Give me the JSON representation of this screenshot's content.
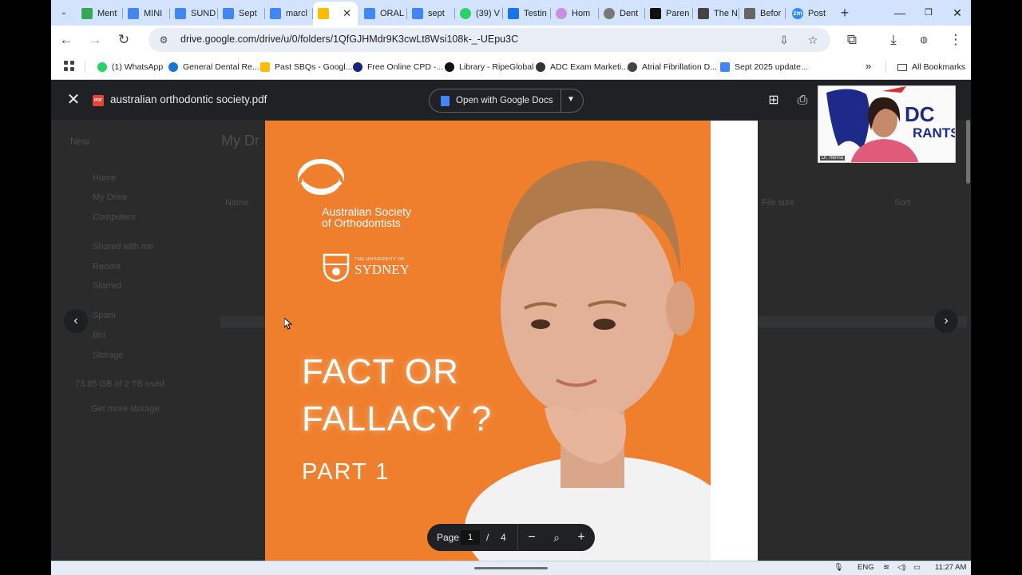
{
  "browser": {
    "tabs": [
      {
        "label": "Ment",
        "fav_color": "#34a853"
      },
      {
        "label": "MINI",
        "fav_color": "#4285f4"
      },
      {
        "label": "SUND",
        "fav_color": "#4285f4"
      },
      {
        "label": "Sept",
        "fav_color": "#4285f4"
      },
      {
        "label": "marcl",
        "fav_color": "#4285f4"
      },
      {
        "label": "",
        "fav_color": "#fbbc04",
        "active": true
      },
      {
        "label": "ORAL",
        "fav_color": "#4285f4"
      },
      {
        "label": "sept",
        "fav_color": "#4285f4"
      },
      {
        "label": "(39) V",
        "fav_color": "#25d366"
      },
      {
        "label": "Testin",
        "fav_color": "#1a73e8"
      },
      {
        "label": "Hom",
        "fav_color": "#c98ee0"
      },
      {
        "label": "Dent",
        "fav_color": "#777777"
      },
      {
        "label": "Paren",
        "fav_color": "#111111"
      },
      {
        "label": "The N",
        "fav_color": "#444444"
      },
      {
        "label": "Befor",
        "fav_color": "#666666"
      },
      {
        "label": "Post",
        "fav_color": "#2d8cff"
      }
    ],
    "zoom_fav_text": "zm",
    "new_tab": "+",
    "url": "drive.google.com/drive/u/0/folders/1QfGJHMdr9K3cwLt8Wsi108k-_-UEpu3C",
    "bookmarks": [
      {
        "label": "(1) WhatsApp",
        "color": "#25d366"
      },
      {
        "label": "General Dental Re...",
        "color": "#1976d2"
      },
      {
        "label": "Past SBQs - Googl...",
        "color": "#fbbc04"
      },
      {
        "label": "Free Online CPD -...",
        "color": "#1a237e"
      },
      {
        "label": "Library - RipeGlobal",
        "color": "#111111"
      },
      {
        "label": "ADC Exam Marketi...",
        "color": "#333333"
      },
      {
        "label": "Atrial Fibrillation D...",
        "color": "#444444"
      },
      {
        "label": "Sept 2025 update...",
        "color": "#4285f4"
      }
    ],
    "more_bookmarks": "»",
    "all_bookmarks": "All Bookmarks"
  },
  "viewer": {
    "file_title": "australian orthodontic society.pdf",
    "pdf_badge": "PDF",
    "open_with_label": "Open with Google Docs",
    "page_label": "Page",
    "current_page": "1",
    "page_sep": "/",
    "total_pages": "4"
  },
  "drive_background": {
    "new": "New",
    "home": "Home",
    "my_drive": "My Drive",
    "computers": "Computers",
    "shared": "Shared with me",
    "recent": "Recent",
    "starred": "Starred",
    "spam": "Spam",
    "bin": "Bin",
    "storage": "Storage",
    "storage_used": "73.85 GB of 2 TB used",
    "get_storage": "Get more storage",
    "heading": "My Dr",
    "col_name": "Name",
    "col_size": "File size",
    "col_sort": "Sort"
  },
  "document": {
    "org_line1": "Australian Society",
    "org_line2": "of Orthodontists",
    "uni_small": "THE UNIVERSITY OF",
    "uni_name": "SYDNEY",
    "headline_line1": "FACT OR",
    "headline_line2": "FALLACY ?",
    "part": "PART 1",
    "cover_color": "#ef7f2c"
  },
  "webcam": {
    "logo_text_top": "DC",
    "logo_text_bottom": "RANTS",
    "name_tag": "Dr. Henna"
  },
  "taskbar": {
    "language": "ENG",
    "time": "11:27 AM"
  }
}
